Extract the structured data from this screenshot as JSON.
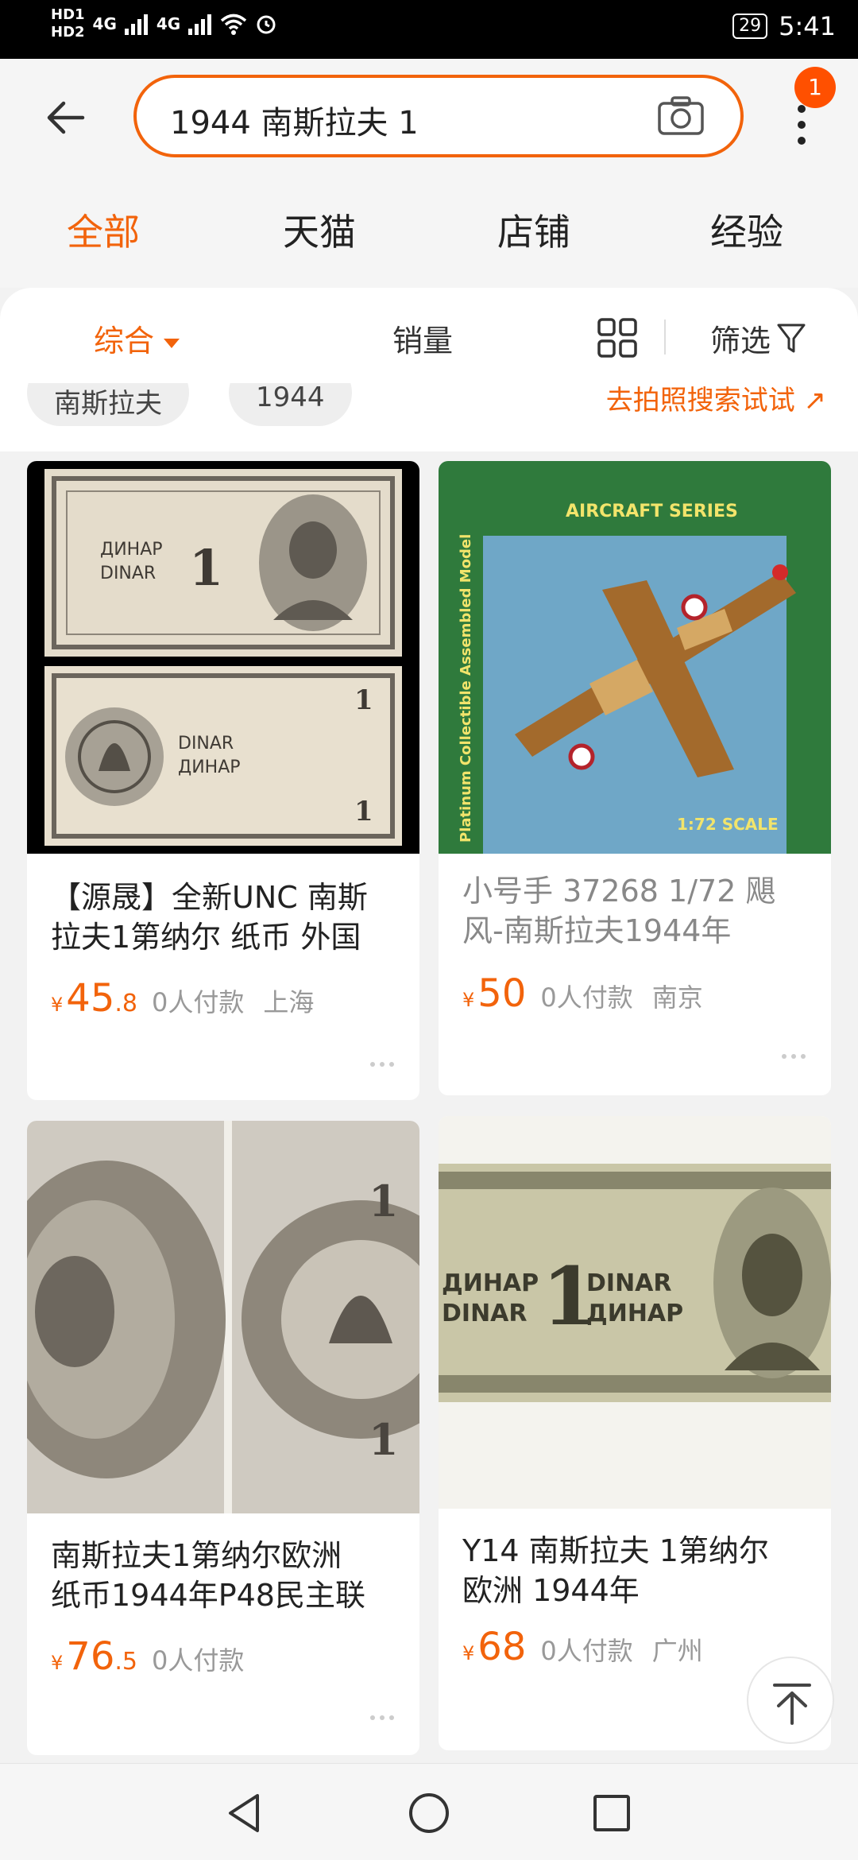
{
  "status_bar": {
    "hd1": "HD1",
    "hd2": "HD2",
    "signal1": "4G",
    "signal2": "4G",
    "battery": "29",
    "time": "5:41"
  },
  "header": {
    "search_value": "1944 南斯拉夫 1",
    "notification_count": "1"
  },
  "tabs": [
    "全部",
    "天猫",
    "店铺",
    "经验"
  ],
  "sort_bar": {
    "comprehensive": "综合",
    "sales": "销量",
    "filter": "筛选"
  },
  "suggestions": {
    "chips": [
      "南斯拉夫",
      "1944"
    ],
    "photo_search_link": "去拍照搜索试试 ↗"
  },
  "products": [
    {
      "title_line1": "【源晟】全新UNC 南斯",
      "title_line2": "拉夫1第纳尔 纸币 外国",
      "price_int": "45",
      "price_dec": ".8",
      "sales": "0人付款",
      "location": "上海"
    },
    {
      "title_line1": "小号手 37268 1/72  飓",
      "title_line2": "风-南斯拉夫1944年",
      "price_int": "50",
      "price_dec": "",
      "sales": "0人付款",
      "location": "南京"
    },
    {
      "title_line1": "南斯拉夫1第纳尔欧洲",
      "title_line2": "纸币1944年P48民主联",
      "price_int": "76",
      "price_dec": ".5",
      "sales": "0人付款",
      "location": ""
    },
    {
      "title_line1": "Y14 南斯拉夫 1第纳尔",
      "title_line2": "欧洲 1944年",
      "price_int": "68",
      "price_dec": "",
      "sales": "0人付款",
      "location": "广州"
    }
  ],
  "currency_symbol": "¥",
  "images": {
    "banknote_top": {
      "line1": "ДИНАР",
      "line2": "DINAR",
      "value": "1"
    },
    "banknote_bottom": {
      "line1": "DINAR",
      "line2": "ДИНАР",
      "value": "1"
    },
    "model_box": {
      "series": "AIRCRAFT SERIES",
      "scale": "1:72 SCALE",
      "side": "Platinum Collectible Assembled Model"
    },
    "note_closeup": {
      "value": "1"
    },
    "note_zoom": {
      "line1": "ДИНАР",
      "line2": "DINAR",
      "line3": "DINAR",
      "line4": "ДИНАР",
      "value": "1"
    }
  },
  "colors": {
    "accent": "#f2630b",
    "badge": "#ff5000",
    "muted_text": "#999999"
  },
  "icons": [
    "back-arrow-icon",
    "camera-icon",
    "more-vertical-icon",
    "caret-down-icon",
    "grid-view-icon",
    "filter-funnel-icon",
    "arrow-to-top-icon",
    "nav-back-icon",
    "nav-home-icon",
    "nav-recents-icon"
  ]
}
